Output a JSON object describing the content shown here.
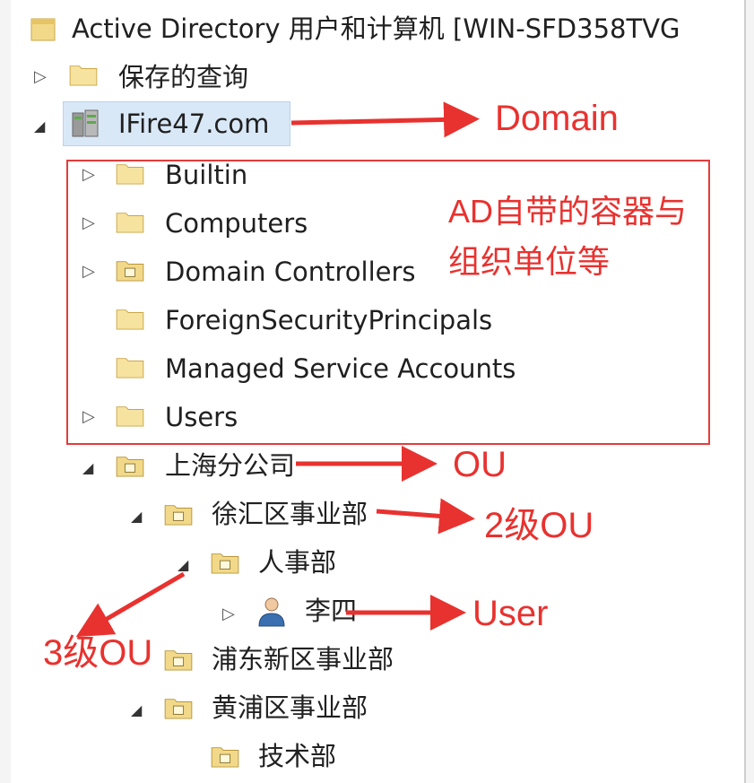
{
  "window": {
    "title": "Active Directory 用户和计算机 [WIN-SFD358TVG"
  },
  "tree": {
    "saved_queries": "保存的查询",
    "domain": "IFire47.com",
    "builtin": "Builtin",
    "computers": "Computers",
    "domain_controllers": "Domain Controllers",
    "foreign_security_principals": "ForeignSecurityPrincipals",
    "managed_service_accounts": "Managed Service Accounts",
    "users": "Users",
    "shanghai_branch": "上海分公司",
    "xuhui_division": "徐汇区事业部",
    "hr_department": "人事部",
    "user_lisi": "李四",
    "pudong_division": "浦东新区事业部",
    "huangpu_division": "黄浦区事业部",
    "tech_department": "技术部"
  },
  "annotations": {
    "domain": "Domain",
    "builtin_containers_line1": "AD自带的容器与",
    "builtin_containers_line2": "组织单位等",
    "ou": "OU",
    "ou_level2": "2级OU",
    "ou_level3": "3级OU",
    "user": "User"
  },
  "colors": {
    "annotation_red": "#e8322f",
    "folder_yellow": "#f2d98a",
    "selection_blue": "#d9e8f7"
  },
  "icons": {
    "folder": "folder-icon",
    "ou_folder": "ou-folder-icon",
    "domain": "domain-icon",
    "user": "user-icon",
    "collapsed": "triangle-right-icon",
    "expanded": "triangle-down-icon"
  }
}
